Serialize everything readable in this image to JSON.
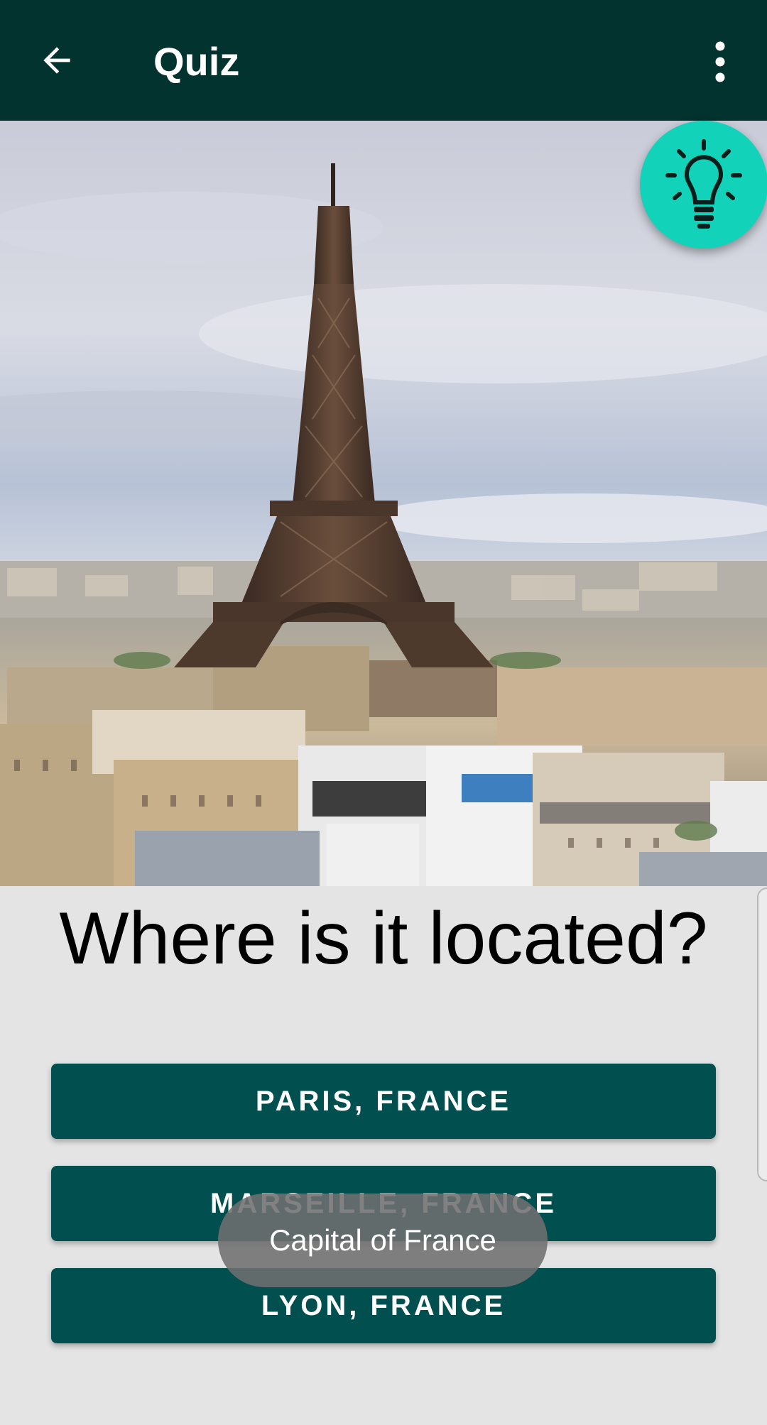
{
  "appbar": {
    "title": "Quiz",
    "back_icon": "arrow-back-icon",
    "menu_icon": "more-vert-icon"
  },
  "photo": {
    "subject": "eiffel-tower-photo"
  },
  "hint": {
    "icon": "lightbulb-icon",
    "color": "#12d3b9"
  },
  "question": "Where is it located?",
  "answers": [
    {
      "label": "PARIS, FRANCE"
    },
    {
      "label": "MARSEILLE, FRANCE"
    },
    {
      "label": "LYON, FRANCE"
    }
  ],
  "toast": "Capital of France",
  "colors": {
    "appbar": "#02332e",
    "button": "#024f4f",
    "background": "#e4e4e4"
  }
}
